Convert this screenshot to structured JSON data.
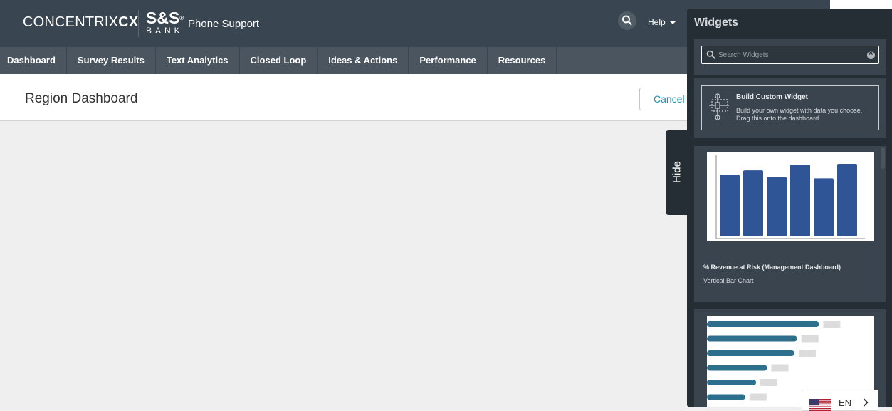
{
  "header": {
    "logo_main": "CONCENTRIX",
    "logo_suffix": "CX",
    "bank_logo_top": "S&S",
    "bank_logo_mark": "®",
    "bank_logo_bottom": "BANK",
    "app_name": "Phone Support",
    "help_label": "Help",
    "search_icon": "search-icon"
  },
  "nav": {
    "items": [
      "Dashboard",
      "Survey Results",
      "Text Analytics",
      "Closed Loop",
      "Ideas & Actions",
      "Performance",
      "Resources"
    ]
  },
  "page": {
    "title": "Region Dashboard",
    "cancel_label": "Cancel"
  },
  "hide_tab": {
    "label": "Hide"
  },
  "widgets_panel": {
    "title": "Widgets",
    "search_placeholder": "Search Widgets",
    "custom_widget": {
      "title": "Build Custom Widget",
      "description": "Build your own widget with data you choose. Drag this onto the dashboard."
    },
    "cards": [
      {
        "name": "% Revenue at Risk (Management Dashboard)",
        "type": "Vertical Bar Chart",
        "preview_bar_values": [
          85,
          91,
          82,
          99,
          80,
          100
        ],
        "preview_color": "#2f5597"
      },
      {
        "preview_bar_values": [
          82,
          66,
          64,
          44,
          36,
          28
        ],
        "preview_color": "#2e6f8e",
        "preview_label_color": "#dcdcdc"
      }
    ]
  },
  "language": {
    "code": "EN",
    "flag_icon": "us-flag-icon"
  },
  "colors": {
    "header_bg": "#394550",
    "nav_bg": "#4a5560",
    "panel_bg": "#252d35",
    "accent": "#1e8fb0"
  }
}
